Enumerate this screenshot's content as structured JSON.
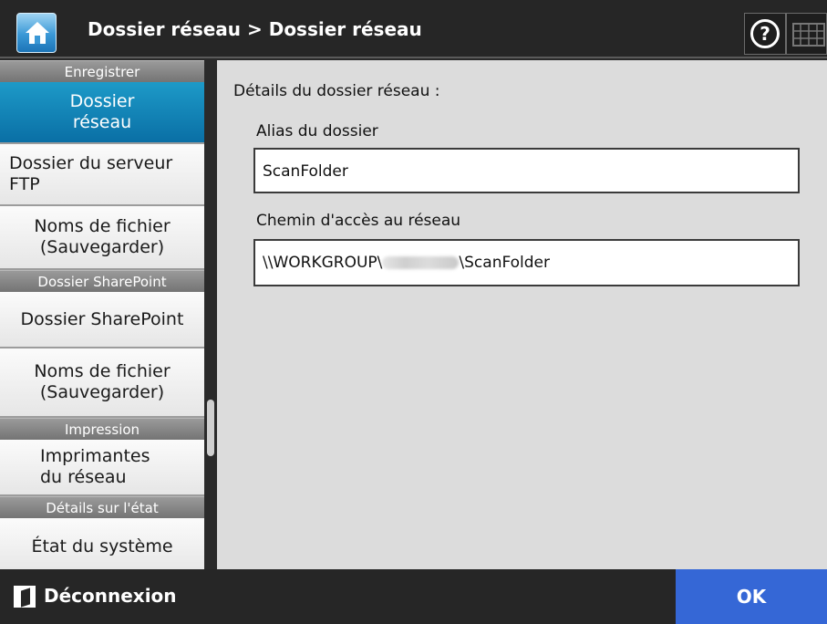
{
  "header": {
    "title": "Dossier réseau > Dossier réseau",
    "home_icon": "home-icon",
    "help_icon": "help-icon",
    "keyboard_icon": "keyboard-icon"
  },
  "sidebar": {
    "sections": [
      {
        "header": "Enregistrer",
        "items": [
          "Dossier réseau",
          "Dossier du serveur FTP",
          "Noms de fichier (Sauvegarder)"
        ]
      },
      {
        "header": "Dossier SharePoint",
        "items": [
          "Dossier SharePoint",
          "Noms de fichier (Sauvegarder)"
        ]
      },
      {
        "header": "Impression",
        "items": [
          "Imprimantes du réseau"
        ]
      },
      {
        "header": "Détails sur l'état",
        "items": [
          "État du système"
        ]
      }
    ],
    "item_lines": {
      "s0i0": [
        "Dossier",
        "réseau"
      ],
      "s0i1": [
        "Dossier du serveur",
        "FTP"
      ],
      "s0i2": [
        "Noms de fichier",
        "(Sauvegarder)"
      ],
      "s1i0": [
        "Dossier SharePoint"
      ],
      "s1i1": [
        "Noms de fichier",
        "(Sauvegarder)"
      ],
      "s2i0": [
        "Imprimantes",
        "du réseau"
      ],
      "s3i0": [
        "État du système"
      ]
    },
    "active_item": "Dossier réseau"
  },
  "main": {
    "section_title": "Détails du dossier réseau :",
    "alias_label": "Alias du dossier",
    "alias_value": "ScanFolder",
    "path_label": "Chemin d'accès au réseau",
    "path_prefix": "\\\\WORKGROUP\\",
    "path_suffix": "\\ScanFolder"
  },
  "footer": {
    "logout_label": "Déconnexion",
    "logout_icon": "logout-icon",
    "ok_label": "OK"
  },
  "colors": {
    "active_item": "#0a6fa5",
    "ok_button": "#3567d6",
    "header_bg": "#262626"
  }
}
